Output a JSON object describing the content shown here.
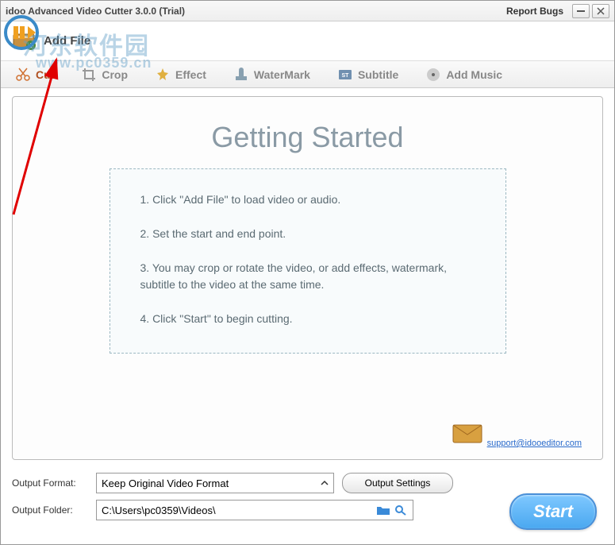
{
  "title": "idoo Advanced Video Cutter 3.0.0 (Trial)",
  "report_bugs": "Report Bugs",
  "watermark_text": "河东软件园",
  "watermark_url": "www.pc0359.cn",
  "addfile": {
    "label": "Add File"
  },
  "tabs": [
    {
      "label": "Cut"
    },
    {
      "label": "Crop"
    },
    {
      "label": "Effect"
    },
    {
      "label": "WaterMark"
    },
    {
      "label": "Subtitle"
    },
    {
      "label": "Add Music"
    }
  ],
  "getting_started": {
    "title": "Getting Started",
    "steps": [
      "1. Click \"Add File\" to load video or audio.",
      "2. Set the start and end point.",
      "3. You may crop or rotate the video, or add effects, watermark, subtitle to the video at the same time.",
      "4. Click \"Start\" to begin cutting."
    ],
    "support_email": "support@idooeditor.com"
  },
  "output": {
    "format_label": "Output Format:",
    "format_value": "Keep Original Video Format",
    "settings_btn": "Output Settings",
    "folder_label": "Output Folder:",
    "folder_value": "C:\\Users\\pc0359\\Videos\\"
  },
  "start_btn": "Start"
}
